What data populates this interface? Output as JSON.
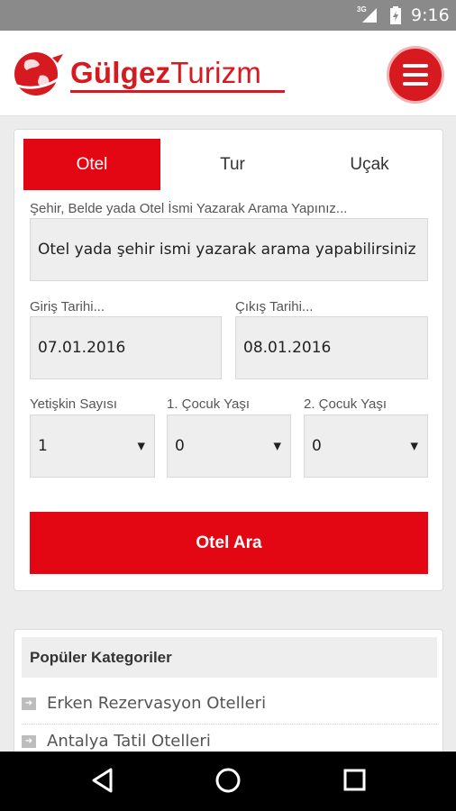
{
  "status_bar": {
    "network": "3G",
    "time": "9:16"
  },
  "header": {
    "brand_bold": "Gülgez",
    "brand_regular": "Turizm"
  },
  "tabs": [
    {
      "label": "Otel",
      "active": true
    },
    {
      "label": "Tur",
      "active": false
    },
    {
      "label": "Uçak",
      "active": false
    }
  ],
  "search": {
    "location_label": "Şehir, Belde yada Otel İsmi Yazarak Arama Yapınız...",
    "location_placeholder": "Otel yada şehir ismi yazarak arama yapabilirsiniz",
    "checkin_label": "Giriş Tarihi...",
    "checkin_value": "07.01.2016",
    "checkout_label": "Çıkış Tarihi...",
    "checkout_value": "08.01.2016",
    "adults_label": "Yetişkin Sayısı",
    "adults_value": "1",
    "child1_label": "1. Çocuk Yaşı",
    "child1_value": "0",
    "child2_label": "2. Çocuk Yaşı",
    "child2_value": "0",
    "button_label": "Otel Ara"
  },
  "categories": {
    "title": "Popüler Kategoriler",
    "items": [
      "Erken Rezervasyon Otelleri",
      "Antalya Tatil Otelleri"
    ]
  },
  "colors": {
    "accent": "#e30613",
    "brand": "#d71920"
  },
  "icons": {
    "status": [
      "signal-icon",
      "battery-icon"
    ],
    "header": [
      "globe-logo-icon",
      "hamburger-menu-icon"
    ],
    "nav": [
      "back-icon",
      "home-icon",
      "recents-icon"
    ]
  }
}
